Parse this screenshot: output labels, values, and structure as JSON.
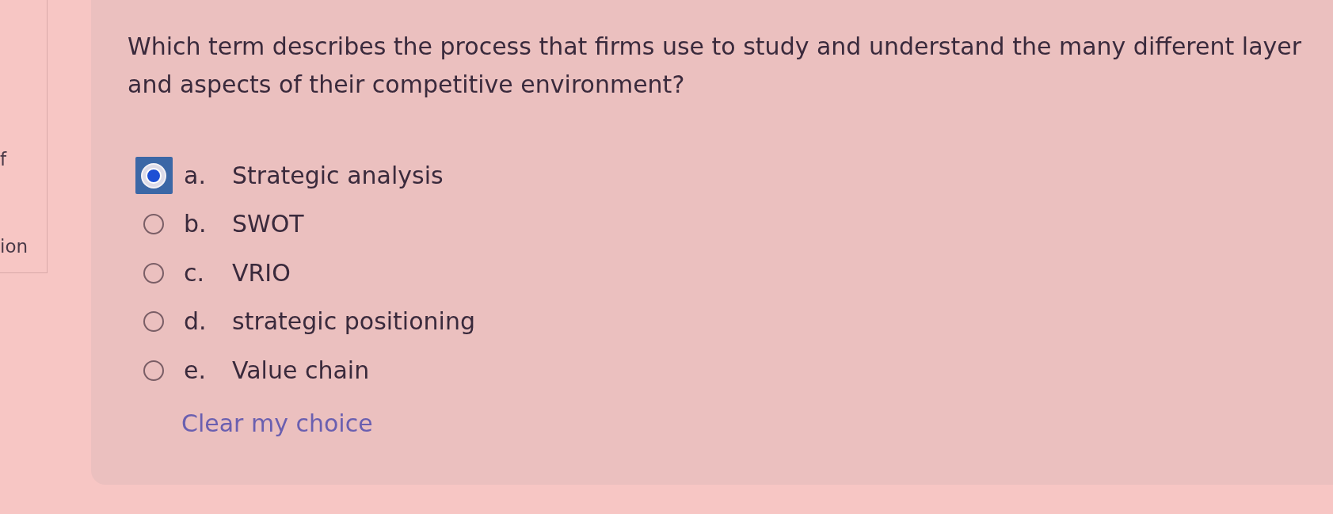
{
  "side_panel": {
    "fragments": [
      "f",
      "ion"
    ]
  },
  "question": {
    "lines": [
      "Which term describes the process that firms use to study and understand the many different layer",
      "and aspects of their competitive environment?"
    ],
    "options": [
      {
        "letter": "a.",
        "text": "Strategic analysis",
        "selected": true
      },
      {
        "letter": "b.",
        "text": "SWOT",
        "selected": false
      },
      {
        "letter": "c.",
        "text": "VRIO",
        "selected": false
      },
      {
        "letter": "d.",
        "text": "strategic positioning",
        "selected": false
      },
      {
        "letter": "e.",
        "text": "Value chain",
        "selected": false
      }
    ],
    "clear_link": "Clear my choice"
  }
}
